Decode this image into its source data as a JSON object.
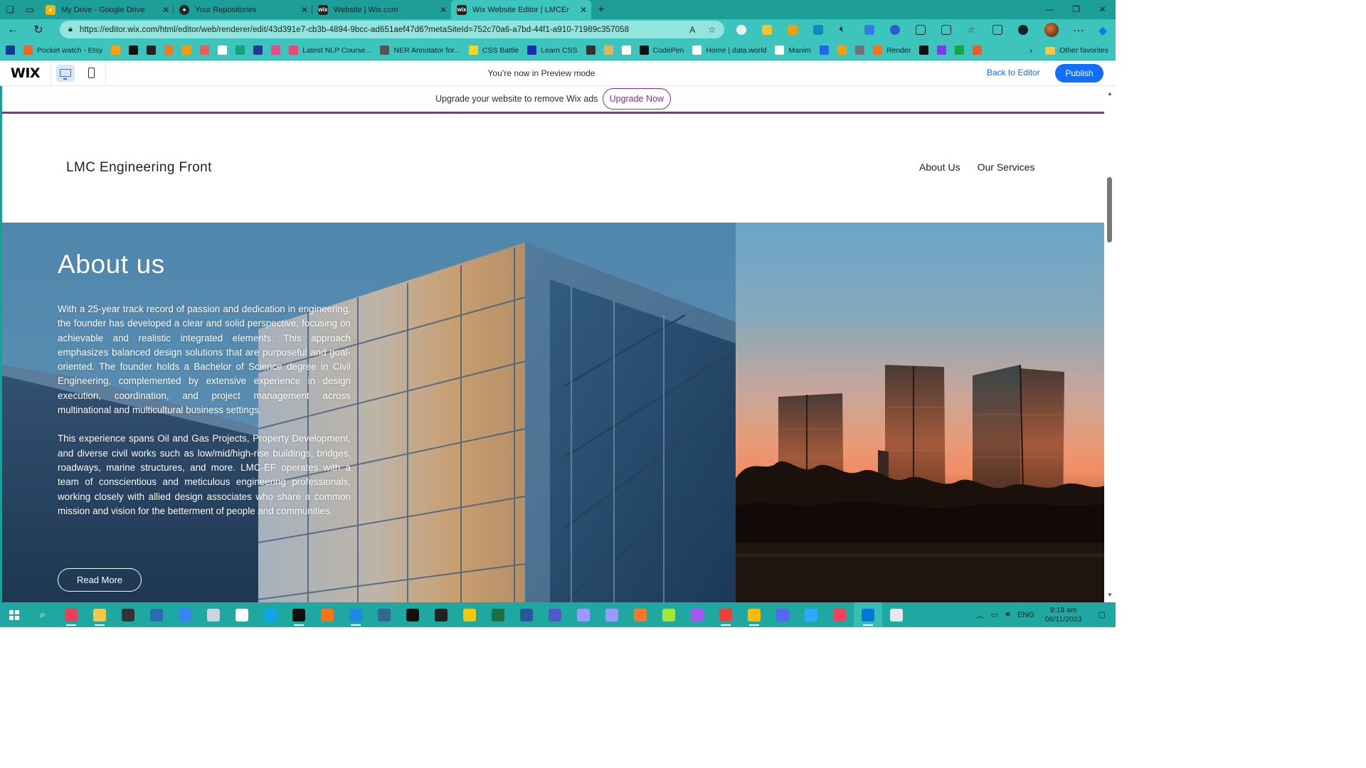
{
  "browser": {
    "tabs": [
      {
        "title": "My Drive - Google Drive",
        "favicon_color": "#f4b400"
      },
      {
        "title": "Your Repositories",
        "favicon_color": "#24292e"
      },
      {
        "title": "Website | Wix.com",
        "favicon_color": "#222222"
      },
      {
        "title": "Wix Website Editor | LMCEngine",
        "favicon_color": "#222222",
        "active": true
      }
    ],
    "url": "https://editor.wix.com/html/editor/web/renderer/edit/43d391e7-cb3b-4894-9bcc-ad651aef47d6?metaSiteId=752c70a6-a7bd-44f1-a910-71989c357058",
    "bookmarks": [
      {
        "label": "",
        "icon": "play-icon",
        "color": "#0b3d91"
      },
      {
        "label": "Pocket watch - Etsy",
        "icon": "etsy-icon",
        "color": "#f1641e"
      },
      {
        "label": "",
        "icon": "bars-icon",
        "color": "#f6a21a"
      },
      {
        "label": "",
        "icon": "amazon-icon",
        "color": "#111111"
      },
      {
        "label": "",
        "icon": "notion-icon",
        "color": "#222222"
      },
      {
        "label": "",
        "icon": "box-icon",
        "color": "#f07a21"
      },
      {
        "label": "",
        "icon": "arrow-up-icon",
        "color": "#f59e0b"
      },
      {
        "label": "",
        "icon": "ring-icon",
        "color": "#e85d4f"
      },
      {
        "label": "",
        "icon": "doc-icon",
        "color": "#ffffff"
      },
      {
        "label": "",
        "icon": "leaf-icon",
        "color": "#10a37f"
      },
      {
        "label": "",
        "icon": "drive-icon",
        "color": "#1e3a8a"
      },
      {
        "label": "",
        "icon": "dribbble-icon",
        "color": "#ea4c89"
      },
      {
        "label": "Latest NLP Course...",
        "icon": "hf-icon",
        "color": "#e8487a"
      },
      {
        "label": "NER Annotator for...",
        "icon": "ner-icon",
        "color": "#555555"
      },
      {
        "label": "CSS Battle",
        "icon": "cssbattle-icon",
        "color": "#f9d71c"
      },
      {
        "label": "Learn CSS",
        "icon": "learncss-icon",
        "color": "#1a2bb5"
      },
      {
        "label": "",
        "icon": "chevron-icon",
        "color": "#333333"
      },
      {
        "label": "",
        "icon": "hand-icon",
        "color": "#e7b45b"
      },
      {
        "label": "",
        "icon": "square-icon",
        "color": "#ffffff"
      },
      {
        "label": "CodePen",
        "icon": "codepen-icon",
        "color": "#111111"
      },
      {
        "label": "Home | data.world",
        "icon": "dataworld-icon",
        "color": "#ffffff"
      },
      {
        "label": "Manim",
        "icon": "manim-icon",
        "color": "#ffffff"
      },
      {
        "label": "",
        "icon": "k-icon",
        "color": "#2563eb"
      },
      {
        "label": "",
        "icon": "swirl-icon",
        "color": "#f59e0b"
      },
      {
        "label": "",
        "icon": "grid-icon",
        "color": "#6b7280"
      },
      {
        "label": "Render",
        "icon": "render-icon",
        "color": "#f97316"
      },
      {
        "label": "",
        "icon": "a-icon",
        "color": "#111111"
      },
      {
        "label": "",
        "icon": "h-icon",
        "color": "#7c3aed"
      },
      {
        "label": "",
        "icon": "w-icon",
        "color": "#16a34a"
      },
      {
        "label": "",
        "icon": "circle-icon",
        "color": "#f15a24"
      }
    ],
    "other_favorites": "Other favorites"
  },
  "wix": {
    "preview_text": "You’re now in Preview mode",
    "back_to_editor": "Back to Editor",
    "publish": "Publish",
    "ad_text": "Upgrade your website to remove Wix ads",
    "upgrade_now": "Upgrade Now",
    "accent": "#116dff",
    "ad_accent": "#8a2d9b"
  },
  "site": {
    "title": "LMC Engineering Front",
    "nav": [
      "About Us",
      "Our Services"
    ],
    "hero": {
      "heading": "About us",
      "paragraph1": "With a 25-year track record of passion and dedication in engineering, the founder has developed a clear and solid perspective, focusing on achievable and realistic integrated elements. This approach emphasizes balanced design solutions that are purposeful and goal-oriented. The founder holds a Bachelor of Science degree in Civil Engineering, complemented by extensive experience in design execution, coordination, and project management across multinational and multicultural business settings.",
      "paragraph2": "This experience spans Oil and Gas Projects, Property Development, and diverse civil works such as low/mid/high-rise buildings, bridges, roadways, marine structures, and more. LMC-EF operates with a team of conscientious and meticulous engineering professionals, working closely with allied design associates who share a common mission and vision for the betterment of people and communities.",
      "button": "Read More"
    }
  },
  "taskbar": {
    "language": "ENG",
    "time": "9:18 am",
    "date": "06/11/2023",
    "accent": "#1fa8a2"
  }
}
